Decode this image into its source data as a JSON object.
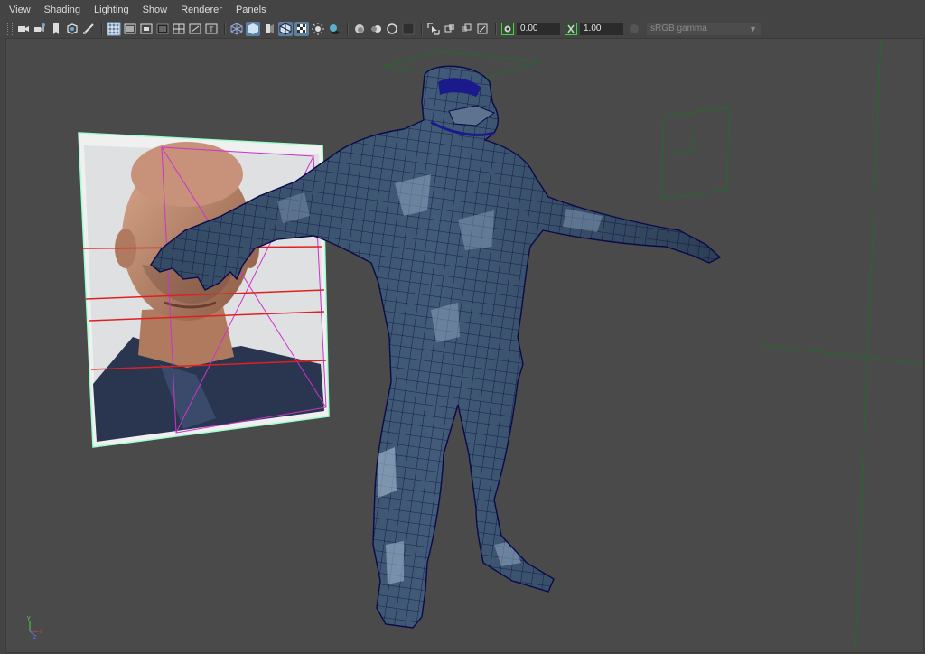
{
  "menu": {
    "view": "View",
    "shading": "Shading",
    "lighting": "Lighting",
    "show": "Show",
    "renderer": "Renderer",
    "panels": "Panels"
  },
  "toolbar": {
    "exposure_value": "0.00",
    "gamma_value": "1.00",
    "color_space": "sRGB gamma"
  },
  "axis": {
    "y_label": "y",
    "x_label": "x",
    "z_label": "z"
  },
  "colors": {
    "viewport_bg": "#4a4a4a",
    "mesh_fill": "#3c5068",
    "wire": "#0a0a4a",
    "grid_line": "#1f6b2b",
    "selection_magenta": "#cc33cc",
    "guide_red": "#e02020",
    "toggle_active": "#5d7fa0"
  }
}
